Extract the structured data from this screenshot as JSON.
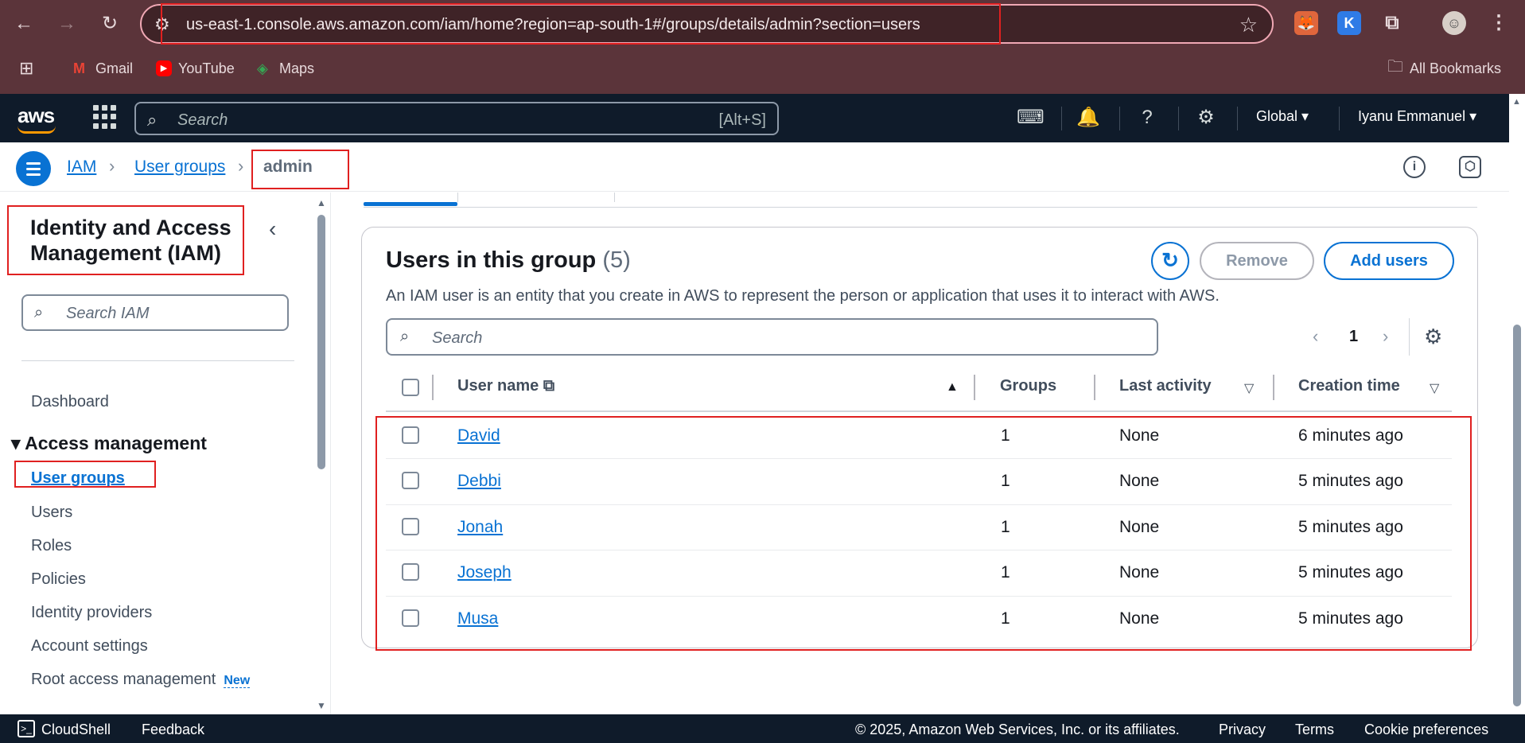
{
  "browser": {
    "url": "us-east-1.console.aws.amazon.com/iam/home?region=ap-south-1#/groups/details/admin?section=users",
    "bookmarks": [
      "Gmail",
      "YouTube",
      "Maps"
    ],
    "all_bookmarks": "All Bookmarks",
    "extensions": [
      "fox-extension-icon",
      "k-extension-icon",
      "puzzle-icon",
      "profile-avatar"
    ]
  },
  "aws_nav": {
    "search_placeholder": "Search",
    "search_shortcut": "[Alt+S]",
    "region": "Global",
    "user": "Iyanu Emmanuel"
  },
  "breadcrumb": {
    "items": [
      "IAM",
      "User groups"
    ],
    "current": "admin"
  },
  "sidenav": {
    "title": "Identity and Access Management (IAM)",
    "search_placeholder": "Search IAM",
    "dashboard": "Dashboard",
    "section": "Access management",
    "items": [
      "User groups",
      "Users",
      "Roles",
      "Policies",
      "Identity providers",
      "Account settings",
      "Root access management"
    ],
    "new_badge": "New"
  },
  "panel": {
    "title": "Users in this group",
    "count": "(5)",
    "description": "An IAM user is an entity that you create in AWS to represent the person or application that uses it to interact with AWS.",
    "remove_label": "Remove",
    "add_label": "Add users",
    "search_placeholder": "Search",
    "page": "1",
    "columns": [
      "User name",
      "Groups",
      "Last activity",
      "Creation time"
    ],
    "rows": [
      {
        "name": "David",
        "groups": "1",
        "last_activity": "None",
        "created": "6 minutes ago"
      },
      {
        "name": "Debbi",
        "groups": "1",
        "last_activity": "None",
        "created": "5 minutes ago"
      },
      {
        "name": "Jonah",
        "groups": "1",
        "last_activity": "None",
        "created": "5 minutes ago"
      },
      {
        "name": "Joseph",
        "groups": "1",
        "last_activity": "None",
        "created": "5 minutes ago"
      },
      {
        "name": "Musa",
        "groups": "1",
        "last_activity": "None",
        "created": "5 minutes ago"
      }
    ]
  },
  "footer": {
    "cloudshell": "CloudShell",
    "feedback": "Feedback",
    "copyright": "© 2025, Amazon Web Services, Inc. or its affiliates.",
    "privacy": "Privacy",
    "terms": "Terms",
    "cookies": "Cookie preferences"
  },
  "colors": {
    "browser_bg": "#5b343a",
    "aws_nav_bg": "#0f1b2a",
    "link": "#0972d3",
    "highlight": "#e02020"
  }
}
